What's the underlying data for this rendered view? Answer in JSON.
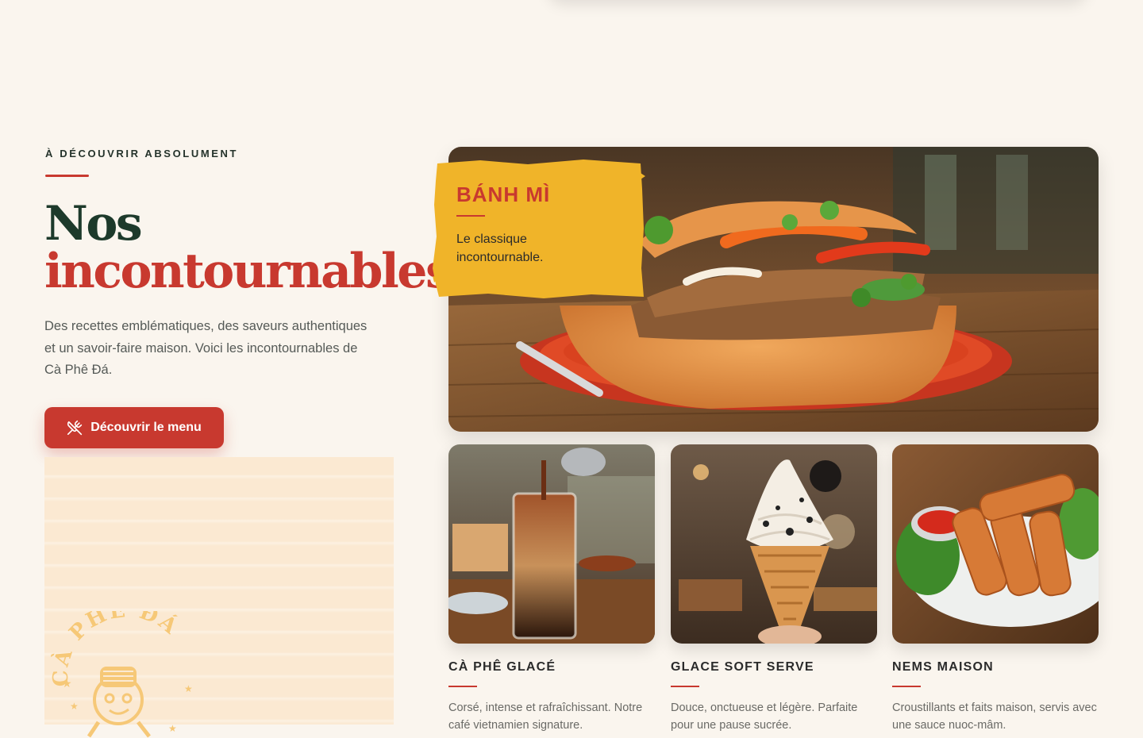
{
  "section": {
    "eyebrow": "À DÉCOUVRIR ABSOLUMENT",
    "title_line1": "Nos",
    "title_line2": "incontournables",
    "lead": "Des recettes emblématiques, des saveurs authentiques et un savoir-faire maison. Voici les incontournables de Cà Phê Đá.",
    "cta_label": "Découvrir le menu",
    "cta_icon": "utensils-crossed-icon"
  },
  "stamp": {
    "text": "CÀ PHÊ ĐÁ"
  },
  "featured": {
    "name": "BÁNH MÌ",
    "description": "Le classique incontournable."
  },
  "cards": [
    {
      "name": "CÀ PHÊ GLACÉ",
      "description": "Corsé, intense et rafraîchissant. Notre café vietnamien signature."
    },
    {
      "name": "GLACE SOFT SERVE",
      "description": "Douce, onctueuse et légère. Parfaite pour une pause sucrée."
    },
    {
      "name": "NEMS MAISON",
      "description": "Croustillants et faits maison, servis avec une sauce nuoc-mâm."
    }
  ],
  "colors": {
    "background": "#faf5ee",
    "accent_red": "#c8392f",
    "title_green": "#1d3a2b",
    "tag_yellow": "#f0b429",
    "paper": "#fbe9d2"
  }
}
